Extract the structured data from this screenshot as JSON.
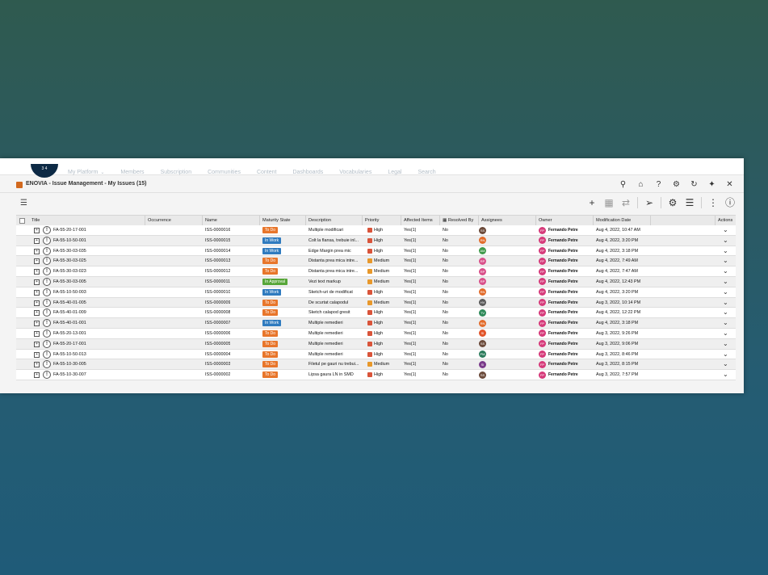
{
  "platform": {
    "compass_label": "3 4",
    "nav": [
      "My Platform",
      "Members",
      "Subscription",
      "Communities",
      "Content",
      "Dashboards",
      "Vocabularies",
      "Legal",
      "Search"
    ]
  },
  "app": {
    "title": "ENOVIA - Issue Management - My Issues (15)"
  },
  "columns": [
    {
      "key": "title",
      "label": "Title"
    },
    {
      "key": "occurrence",
      "label": "Occurrence"
    },
    {
      "key": "name",
      "label": "Name"
    },
    {
      "key": "state",
      "label": "Maturity State"
    },
    {
      "key": "description",
      "label": "Description"
    },
    {
      "key": "priority",
      "label": "Priority"
    },
    {
      "key": "affected",
      "label": "Affected Items"
    },
    {
      "key": "resolved",
      "label": "Resolved By"
    },
    {
      "key": "assignees",
      "label": "Assignees"
    },
    {
      "key": "owner",
      "label": "Owner"
    },
    {
      "key": "modified",
      "label": "Modification Date"
    },
    {
      "key": "actions",
      "label": "Actions"
    }
  ],
  "rows": [
    {
      "title": "FA-55-20-17-001",
      "name": "ISS-0000016",
      "state": "To Do",
      "state_kind": "todo",
      "description": "Multiple modificari",
      "priority": "High",
      "affected": "Yes(1)",
      "resolved": "No",
      "assignee": "SS",
      "assignee_color": "#6b4a3a",
      "owner": "Fernando Petre",
      "owner_initials": "FP",
      "modified": "Aug 4, 2022, 10:47 AM"
    },
    {
      "title": "FA-55-10-50-001",
      "name": "ISS-0000015",
      "state": "In Work",
      "state_kind": "inwork",
      "description": "Colt la flansa, trebuie inl...",
      "priority": "High",
      "affected": "Yes(1)",
      "resolved": "No",
      "assignee": "RN",
      "assignee_color": "#e26b2a",
      "owner": "Fernando Petre",
      "owner_initials": "FP",
      "modified": "Aug 4, 2022, 3:20 PM"
    },
    {
      "title": "FA-55-30-03-035",
      "name": "ISS-0000014",
      "state": "In Work",
      "state_kind": "inwork",
      "description": "Edge Margin prea mic",
      "priority": "High",
      "affected": "Yes(1)",
      "resolved": "No",
      "assignee": "AM",
      "assignee_color": "#3f9a4a",
      "owner": "Fernando Petre",
      "owner_initials": "FP",
      "modified": "Aug 4, 2022, 3:18 PM"
    },
    {
      "title": "FA-55-30-03-025",
      "name": "ISS-0000013",
      "state": "To Do",
      "state_kind": "todo",
      "description": "Distanta prea mica intre...",
      "priority": "Medium",
      "affected": "Yes(1)",
      "resolved": "No",
      "assignee": "RP",
      "assignee_color": "#d9508a",
      "owner": "Fernando Petre",
      "owner_initials": "FP",
      "modified": "Aug 4, 2022, 7:49 AM"
    },
    {
      "title": "FA-55-30-03-023",
      "name": "ISS-0000012",
      "state": "To Do",
      "state_kind": "todo",
      "description": "Distanta prea mica intre...",
      "priority": "Medium",
      "affected": "Yes(1)",
      "resolved": "No",
      "assignee": "RP",
      "assignee_color": "#d9508a",
      "owner": "Fernando Petre",
      "owner_initials": "FP",
      "modified": "Aug 4, 2022, 7:47 AM"
    },
    {
      "title": "FA-55-30-03-005",
      "name": "ISS-0000011",
      "state": "In Approval",
      "state_kind": "approval",
      "description": "Vezi text markup",
      "priority": "Medium",
      "affected": "Yes(1)",
      "resolved": "No",
      "assignee": "RP",
      "assignee_color": "#d9508a",
      "owner": "Fernando Petre",
      "owner_initials": "FP",
      "modified": "Aug 4, 2022, 12:43 PM"
    },
    {
      "title": "FA-55-10-50-003",
      "name": "ISS-0000010",
      "state": "In Work",
      "state_kind": "inwork",
      "description": "Sketch-uri de modificat",
      "priority": "High",
      "affected": "Yes(1)",
      "resolved": "No",
      "assignee": "RN",
      "assignee_color": "#e26b2a",
      "owner": "Fernando Petre",
      "owner_initials": "FP",
      "modified": "Aug 4, 2022, 3:20 PM"
    },
    {
      "title": "FA-55-40-01-005",
      "name": "ISS-0000009",
      "state": "To Do",
      "state_kind": "todo",
      "description": "De scurtat calapodul",
      "priority": "Medium",
      "affected": "Yes(1)",
      "resolved": "No",
      "assignee": "HV",
      "assignee_color": "#5a5a5a",
      "owner": "Fernando Petre",
      "owner_initials": "FP",
      "modified": "Aug 3, 2022, 10:14 PM"
    },
    {
      "title": "FA-55-40-01-009",
      "name": "ISS-0000008",
      "state": "To Do",
      "state_kind": "todo",
      "description": "Sketch calapod gresit",
      "priority": "High",
      "affected": "Yes(1)",
      "resolved": "No",
      "assignee": "TV",
      "assignee_color": "#2f8a5a",
      "owner": "Fernando Petre",
      "owner_initials": "FP",
      "modified": "Aug 4, 2022, 12:22 PM"
    },
    {
      "title": "FA-55-40-01-001",
      "name": "ISS-0000007",
      "state": "In Work",
      "state_kind": "inwork",
      "description": "Multiple remedieri",
      "priority": "High",
      "affected": "Yes(1)",
      "resolved": "No",
      "assignee": "RN",
      "assignee_color": "#e26b2a",
      "owner": "Fernando Petre",
      "owner_initials": "FP",
      "modified": "Aug 4, 2022, 3:18 PM"
    },
    {
      "title": "FA-55-20-13-001",
      "name": "ISS-0000006",
      "state": "To Do",
      "state_kind": "todo",
      "description": "Multiple remedieri",
      "priority": "High",
      "affected": "Yes(1)",
      "resolved": "No",
      "assignee": "SI",
      "assignee_color": "#e2552a",
      "owner": "Fernando Petre",
      "owner_initials": "FP",
      "modified": "Aug 3, 2022, 9:26 PM"
    },
    {
      "title": "FA-55-20-17-001",
      "name": "ISS-0000005",
      "state": "To Do",
      "state_kind": "todo",
      "description": "Multiple remedieri",
      "priority": "High",
      "affected": "Yes(1)",
      "resolved": "No",
      "assignee": "SS",
      "assignee_color": "#6b4a3a",
      "owner": "Fernando Petre",
      "owner_initials": "FP",
      "modified": "Aug 3, 2022, 9:06 PM"
    },
    {
      "title": "FA-55-10-50-013",
      "name": "ISS-0000004",
      "state": "To Do",
      "state_kind": "todo",
      "description": "Multiple remedieri",
      "priority": "High",
      "affected": "Yes(1)",
      "resolved": "No",
      "assignee": "PM",
      "assignee_color": "#2a7a5a",
      "owner": "Fernando Petre",
      "owner_initials": "FP",
      "modified": "Aug 3, 2022, 8:46 PM"
    },
    {
      "title": "FA-55-10-30-005",
      "name": "ISS-0000003",
      "state": "To Do",
      "state_kind": "todo",
      "description": "Filetul pe gauri nu trebui...",
      "priority": "Medium",
      "affected": "Yes(1)",
      "resolved": "No",
      "assignee": "SI",
      "assignee_color": "#7a3a8a",
      "owner": "Fernando Petre",
      "owner_initials": "FP",
      "modified": "Aug 3, 2022, 8:15 PM"
    },
    {
      "title": "FA-55-10-30-007",
      "name": "ISS-0000002",
      "state": "To Do",
      "state_kind": "todo",
      "description": "Lipsa gaura LN in SMD",
      "priority": "High",
      "affected": "Yes(1)",
      "resolved": "No",
      "assignee": "SS",
      "assignee_color": "#6b4a3a",
      "owner": "Fernando Petre",
      "owner_initials": "FP",
      "modified": "Aug 3, 2022, 7:57 PM"
    }
  ]
}
